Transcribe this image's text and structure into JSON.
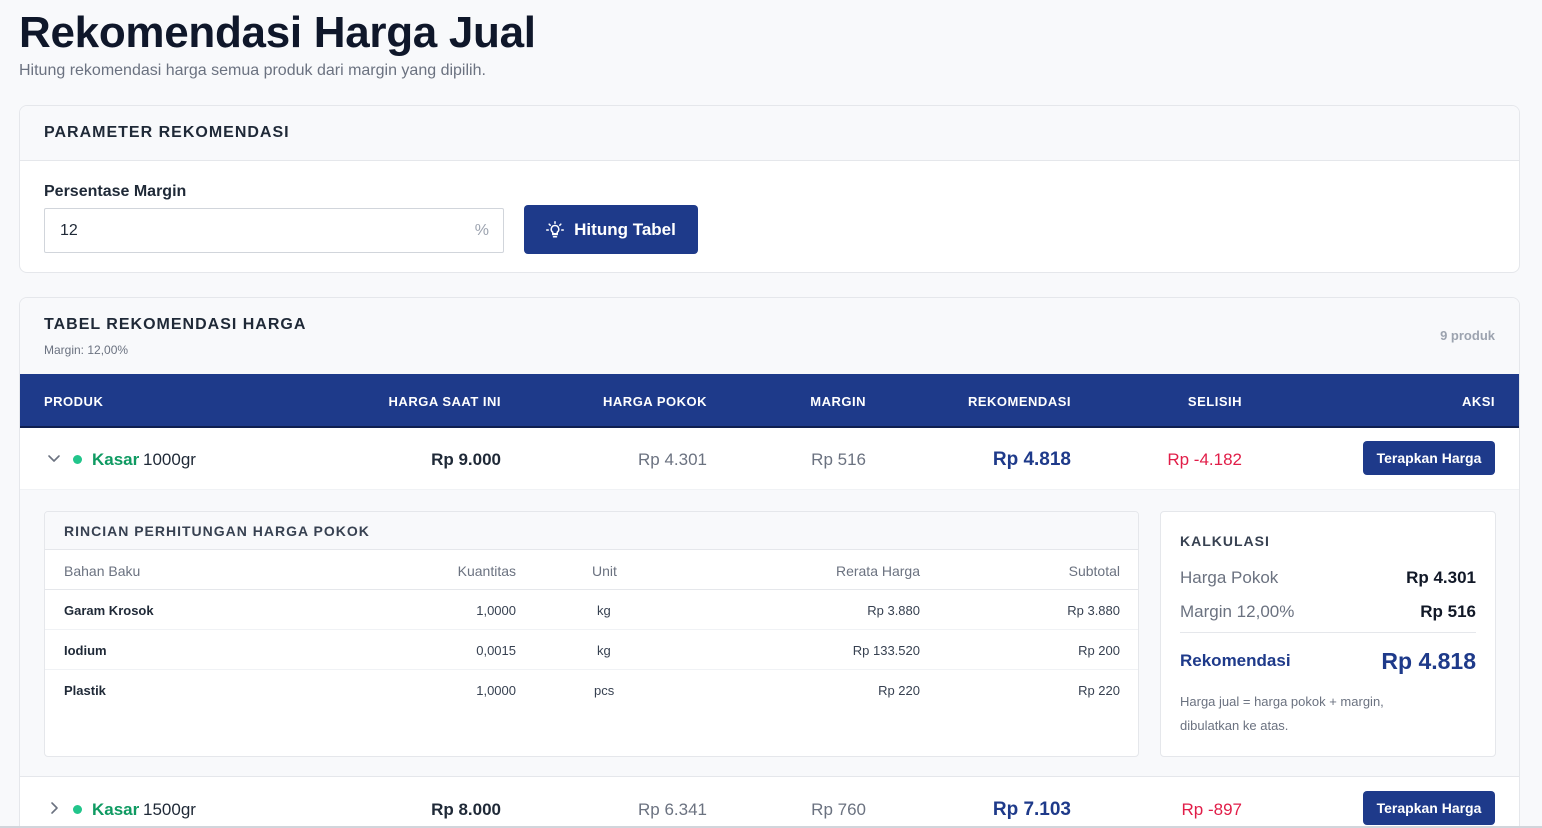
{
  "page": {
    "title": "Rekomendasi Harga Jual",
    "subtitle": "Hitung rekomendasi harga semua produk dari margin yang dipilih."
  },
  "parameter": {
    "title": "PARAMETER REKOMENDASI",
    "margin_label": "Persentase Margin",
    "margin_value": "12",
    "margin_suffix": "%",
    "button_label": "Hitung Tabel",
    "button_icon": "lightbulb-icon"
  },
  "table": {
    "title": "TABEL REKOMENDASI HARGA",
    "subtitle": "Margin: 12,00%",
    "count": "9 produk",
    "columns": [
      "PRODUK",
      "HARGA SAAT INI",
      "HARGA POKOK",
      "MARGIN",
      "REKOMENDASI",
      "SELISIH",
      "AKSI"
    ],
    "rows": [
      {
        "category": "Kasar",
        "name": "1000gr",
        "current_price": "Rp 9.000",
        "cost_price": "Rp 4.301",
        "margin": "Rp 516",
        "recommendation": "Rp 4.818",
        "difference": "Rp -4.182",
        "action": "Terapkan Harga",
        "expanded": true
      },
      {
        "category": "Kasar",
        "name": "1500gr",
        "current_price": "Rp 8.000",
        "cost_price": "Rp 6.341",
        "margin": "Rp 760",
        "recommendation": "Rp 7.103",
        "difference": "Rp -897",
        "action": "Terapkan Harga",
        "expanded": false
      }
    ]
  },
  "breakdown": {
    "title": "RINCIAN PERHITUNGAN HARGA POKOK",
    "columns": [
      "Bahan Baku",
      "Kuantitas",
      "Unit",
      "Rerata Harga",
      "Subtotal"
    ],
    "rows": [
      {
        "material": "Garam Krosok",
        "qty": "1,0000",
        "unit": "kg",
        "avg": "Rp 3.880",
        "subtotal": "Rp 3.880"
      },
      {
        "material": "Iodium",
        "qty": "0,0015",
        "unit": "kg",
        "avg": "Rp 133.520",
        "subtotal": "Rp 200"
      },
      {
        "material": "Plastik",
        "qty": "1,0000",
        "unit": "pcs",
        "avg": "Rp 220",
        "subtotal": "Rp 220"
      }
    ]
  },
  "calc": {
    "title": "KALKULASI",
    "cost_label": "Harga Pokok",
    "cost_value": "Rp 4.301",
    "margin_label": "Margin 12,00%",
    "margin_value": "Rp 516",
    "rec_label": "Rekomendasi",
    "rec_value": "Rp 4.818",
    "note": "Harga jual = harga pokok + margin, dibulatkan ke atas."
  },
  "colors": {
    "primary": "#1e3a8a",
    "success": "#0f9a62",
    "danger": "#e11d48"
  }
}
